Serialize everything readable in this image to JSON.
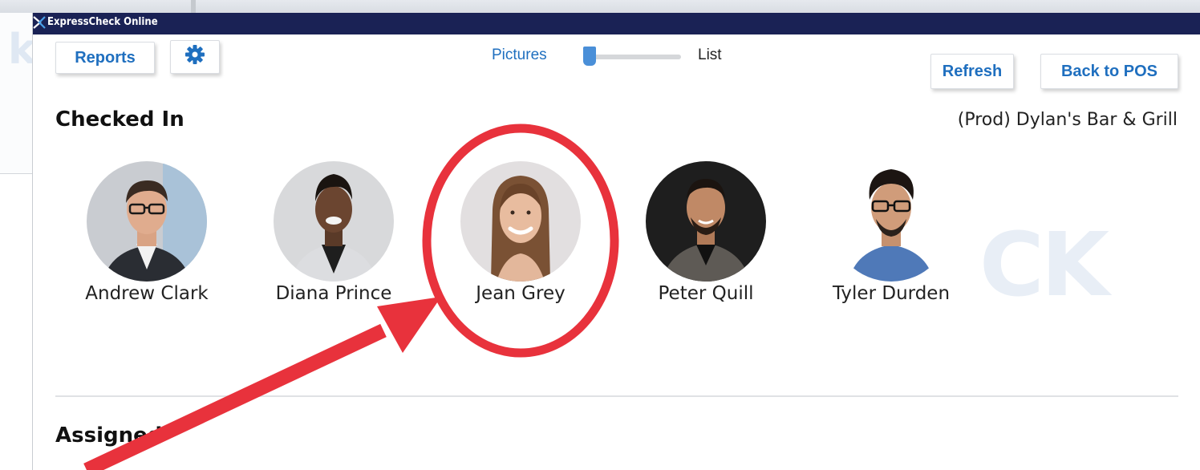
{
  "window": {
    "title": "ExpressCheck Online"
  },
  "toolbar": {
    "reports_label": "Reports",
    "settings_icon": "gear-icon",
    "refresh_label": "Refresh",
    "back_label": "Back to POS"
  },
  "view_toggle": {
    "pictures_label": "Pictures",
    "list_label": "List",
    "selected": "Pictures"
  },
  "checked_in": {
    "title": "Checked In",
    "location": "(Prod) Dylan's Bar & Grill",
    "people": [
      {
        "name": "Andrew Clark"
      },
      {
        "name": "Diana Prince"
      },
      {
        "name": "Jean Grey"
      },
      {
        "name": "Peter Quill"
      },
      {
        "name": "Tyler Durden"
      }
    ]
  },
  "assigned": {
    "title": "Assigned"
  },
  "watermark": "CK",
  "colors": {
    "title_bar": "#1a2255",
    "accent": "#1f6fbf",
    "annotation": "#e8323c"
  }
}
